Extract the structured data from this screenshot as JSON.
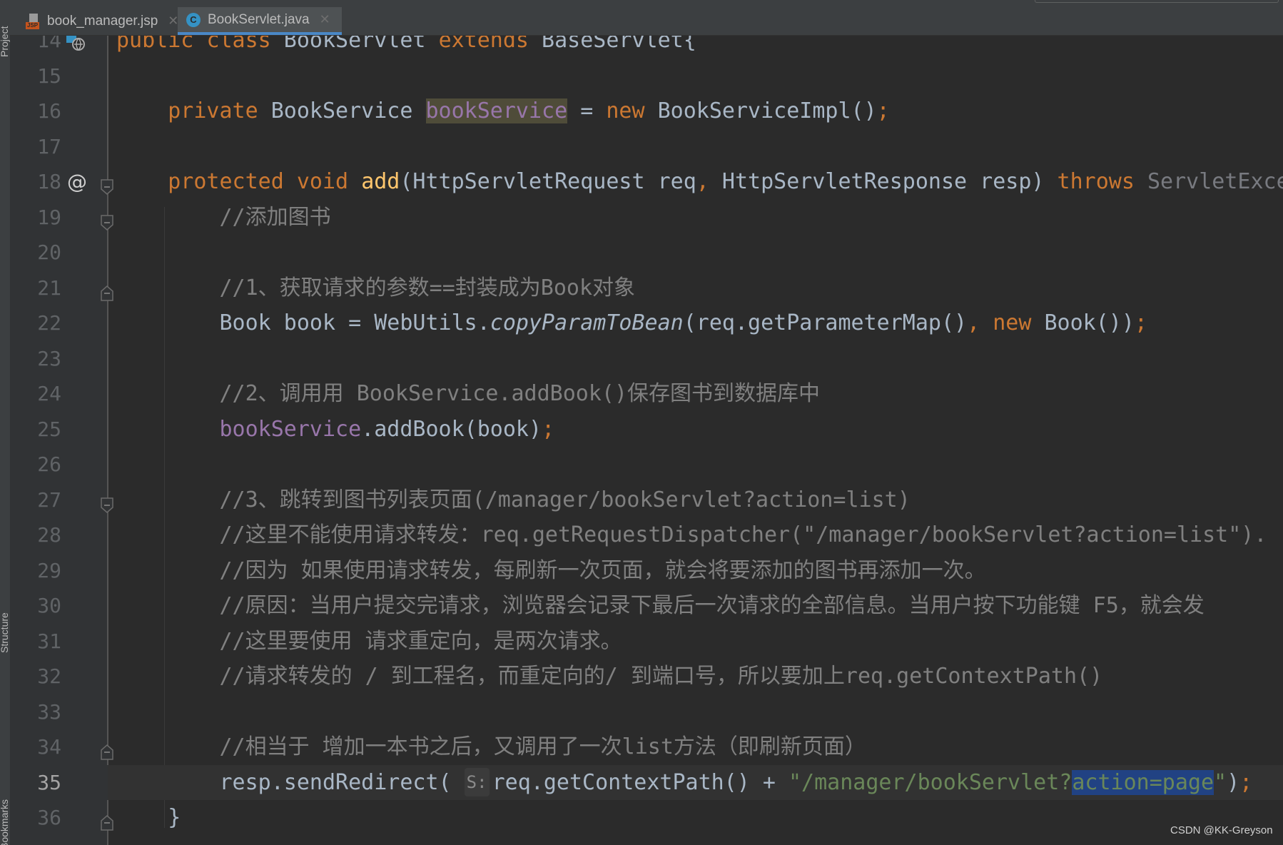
{
  "tabs": [
    {
      "label": "book_manager.jsp",
      "icon": "jsp-file-icon",
      "icon_text": "JSP",
      "active": false
    },
    {
      "label": "BookServlet.java",
      "icon": "java-class-icon",
      "icon_text": "C",
      "active": true
    }
  ],
  "tool_windows": [
    "Project",
    "Structure",
    "Bookmarks"
  ],
  "colors": {
    "editor_bg": "#2b2b2b",
    "gutter_bg": "#313335",
    "keyword": "#cc7832",
    "text": "#a9b7c6",
    "comment": "#808080",
    "field": "#9876aa",
    "string": "#6a8759",
    "method_decl": "#ffc66d",
    "selection": "#214283",
    "active_tab_underline": "#4a88c7"
  },
  "editor": {
    "current_line": 35,
    "lines": [
      {
        "n": "14",
        "gutter": "implementing-class-icon",
        "tokens": [
          [
            "public",
            "kw"
          ],
          [
            " ",
            ""
          ],
          [
            "class",
            "kw"
          ],
          [
            " BookServlet ",
            ""
          ],
          [
            "extends",
            "kw"
          ],
          [
            " BaseServlet{",
            ""
          ]
        ]
      },
      {
        "n": "15",
        "tokens": []
      },
      {
        "n": "16",
        "tokens": [
          [
            "    ",
            ""
          ],
          [
            "private",
            "kw"
          ],
          [
            " BookService ",
            ""
          ],
          [
            "bookService",
            "fd hl"
          ],
          [
            " = ",
            ""
          ],
          [
            "new",
            "kw"
          ],
          [
            " BookServiceImpl()",
            ""
          ],
          [
            ";",
            "kw"
          ]
        ]
      },
      {
        "n": "17",
        "tokens": []
      },
      {
        "n": "18",
        "gutter": "override-at-icon",
        "fold": "open",
        "tokens": [
          [
            "    ",
            ""
          ],
          [
            "protected",
            "kw"
          ],
          [
            " ",
            ""
          ],
          [
            "void",
            "kw"
          ],
          [
            " ",
            ""
          ],
          [
            "add",
            "md"
          ],
          [
            "(HttpServletRequest req",
            ""
          ],
          [
            ",",
            "kw"
          ],
          [
            " HttpServletResponse resp) ",
            ""
          ],
          [
            "throws",
            "kw"
          ],
          [
            " ServletExce",
            "gr"
          ]
        ]
      },
      {
        "n": "19",
        "fold": "open",
        "tokens": [
          [
            "        ",
            ""
          ],
          [
            "//添加图书",
            "cm"
          ]
        ]
      },
      {
        "n": "20",
        "tokens": []
      },
      {
        "n": "21",
        "fold": "close",
        "tokens": [
          [
            "        ",
            ""
          ],
          [
            "//1、获取请求的参数==封装成为Book对象",
            "cm"
          ]
        ]
      },
      {
        "n": "22",
        "tokens": [
          [
            "        ",
            ""
          ],
          [
            "Book book = WebUtils.",
            ""
          ],
          [
            "copyParamToBean",
            "it"
          ],
          [
            "(req.getParameterMap()",
            ""
          ],
          [
            ",",
            "kw"
          ],
          [
            " ",
            ""
          ],
          [
            "new",
            "kw"
          ],
          [
            " Book())",
            ""
          ],
          [
            ";",
            "kw"
          ]
        ]
      },
      {
        "n": "23",
        "tokens": []
      },
      {
        "n": "24",
        "tokens": [
          [
            "        ",
            ""
          ],
          [
            "//2、调用用 BookService.addBook()保存图书到数据库中",
            "cm"
          ]
        ]
      },
      {
        "n": "25",
        "tokens": [
          [
            "        ",
            ""
          ],
          [
            "bookService",
            "fd"
          ],
          [
            ".addBook(book)",
            ""
          ],
          [
            ";",
            "kw"
          ]
        ]
      },
      {
        "n": "26",
        "tokens": []
      },
      {
        "n": "27",
        "fold": "open",
        "tokens": [
          [
            "        ",
            ""
          ],
          [
            "//3、跳转到图书列表页面(/manager/bookServlet?action=list)",
            "cm"
          ]
        ]
      },
      {
        "n": "28",
        "tokens": [
          [
            "        ",
            ""
          ],
          [
            "//这里不能使用请求转发：req.getRequestDispatcher(\"/manager/bookServlet?action=list\").",
            "cm"
          ]
        ]
      },
      {
        "n": "29",
        "tokens": [
          [
            "        ",
            ""
          ],
          [
            "//因为 如果使用请求转发，每刷新一次页面，就会将要添加的图书再添加一次。",
            "cm"
          ]
        ]
      },
      {
        "n": "30",
        "tokens": [
          [
            "        ",
            ""
          ],
          [
            "//原因：当用户提交完请求，浏览器会记录下最后一次请求的全部信息。当用户按下功能键 F5，就会发",
            "cm"
          ]
        ]
      },
      {
        "n": "31",
        "tokens": [
          [
            "        ",
            ""
          ],
          [
            "//这里要使用 请求重定向，是两次请求。",
            "cm"
          ]
        ]
      },
      {
        "n": "32",
        "tokens": [
          [
            "        ",
            ""
          ],
          [
            "//请求转发的 / 到工程名，而重定向的/ 到端口号，所以要加上req.getContextPath()",
            "cm"
          ]
        ]
      },
      {
        "n": "33",
        "tokens": []
      },
      {
        "n": "34",
        "fold": "close",
        "tokens": [
          [
            "        ",
            ""
          ],
          [
            "//相当于 增加一本书之后，又调用了一次list方法（即刷新页面）",
            "cm"
          ]
        ]
      },
      {
        "n": "35",
        "tokens": [
          [
            "        ",
            ""
          ],
          [
            "resp.sendRedirect( ",
            ""
          ],
          [
            "S:",
            "hint"
          ],
          [
            "req.getContextPath() + ",
            ""
          ],
          [
            "\"/manager/bookServlet?",
            "st"
          ],
          [
            "action=page",
            "st sel"
          ],
          [
            "\"",
            "st"
          ],
          [
            ")",
            ""
          ],
          [
            ";",
            "kw"
          ]
        ]
      },
      {
        "n": "36",
        "fold": "close",
        "tokens": [
          [
            "    ",
            ""
          ],
          [
            "}",
            ""
          ]
        ]
      }
    ]
  },
  "watermark": "CSDN @KK-Greyson"
}
